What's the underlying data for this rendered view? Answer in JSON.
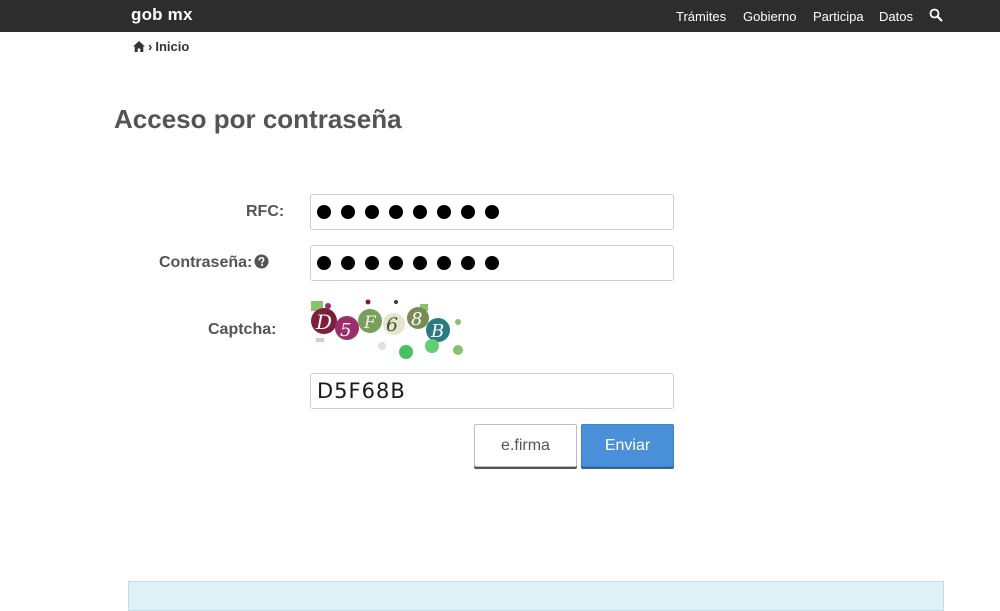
{
  "header": {
    "brand": "gob mx",
    "nav": [
      {
        "label": "Trámites"
      },
      {
        "label": "Gobierno"
      },
      {
        "label": "Participa"
      },
      {
        "label": "Datos"
      }
    ],
    "search_icon": "search-icon"
  },
  "breadcrumb": {
    "home_icon": "home-icon",
    "separator": "›",
    "current": "Inicio"
  },
  "page": {
    "title": "Acceso por contraseña"
  },
  "form": {
    "rfc": {
      "label": "RFC:",
      "masked_length": 8
    },
    "password": {
      "label": "Contraseña:",
      "help_icon": "question-circle-icon",
      "masked_length": 8
    },
    "captcha": {
      "label": "Captcha:",
      "image_text": "D5F68B",
      "value": "D5F68B"
    },
    "buttons": {
      "efirma": "e.firma",
      "submit": "Enviar"
    }
  },
  "colors": {
    "topbar": "#2d2d2d",
    "primary_button": "#4a90d9",
    "info_box": "#dff0f7"
  }
}
